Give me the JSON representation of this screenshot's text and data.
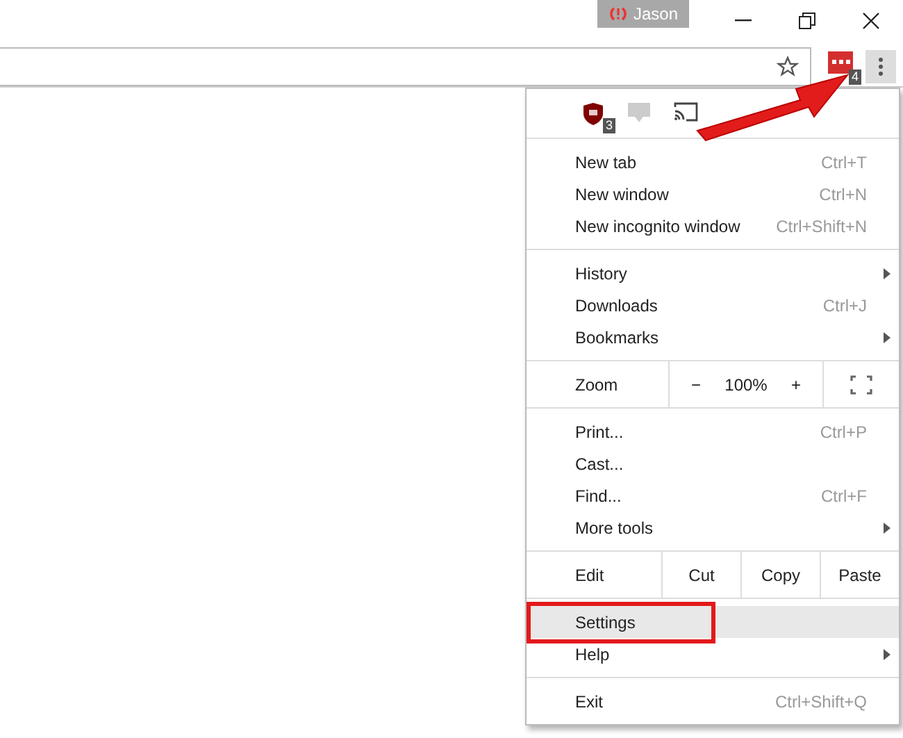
{
  "title_bar": {
    "profile": "Jason"
  },
  "toolbar": {
    "extension_badge": "4"
  },
  "menu": {
    "extensions": [
      {
        "kind": "shield",
        "badge": "3"
      },
      {
        "kind": "css"
      },
      {
        "kind": "cast"
      }
    ],
    "sections": [
      {
        "kind": "items",
        "items": [
          {
            "label": "New tab",
            "shortcut": "Ctrl+T",
            "submenu": false,
            "selected": false
          },
          {
            "label": "New window",
            "shortcut": "Ctrl+N",
            "submenu": false,
            "selected": false
          },
          {
            "label": "New incognito window",
            "shortcut": "Ctrl+Shift+N",
            "submenu": false,
            "selected": false
          }
        ]
      },
      {
        "kind": "items",
        "items": [
          {
            "label": "History",
            "submenu": true,
            "selected": false
          },
          {
            "label": "Downloads",
            "shortcut": "Ctrl+J",
            "submenu": false,
            "selected": false
          },
          {
            "label": "Bookmarks",
            "submenu": true,
            "selected": false
          }
        ]
      },
      {
        "kind": "zoom",
        "label": "Zoom",
        "minus": "−",
        "value": "100%",
        "plus": "+"
      },
      {
        "kind": "items",
        "items": [
          {
            "label": "Print...",
            "shortcut": "Ctrl+P",
            "submenu": false,
            "selected": false
          },
          {
            "label": "Cast...",
            "submenu": false,
            "selected": false
          },
          {
            "label": "Find...",
            "shortcut": "Ctrl+F",
            "submenu": false,
            "selected": false
          },
          {
            "label": "More tools",
            "submenu": true,
            "selected": false
          }
        ]
      },
      {
        "kind": "edit",
        "label": "Edit",
        "buttons": [
          "Cut",
          "Copy",
          "Paste"
        ]
      },
      {
        "kind": "items",
        "items": [
          {
            "label": "Settings",
            "submenu": false,
            "selected": true
          },
          {
            "label": "Help",
            "submenu": true,
            "selected": false
          }
        ]
      },
      {
        "kind": "items",
        "items": [
          {
            "label": "Exit",
            "shortcut": "Ctrl+Shift+Q",
            "submenu": false,
            "selected": false
          }
        ]
      }
    ]
  }
}
